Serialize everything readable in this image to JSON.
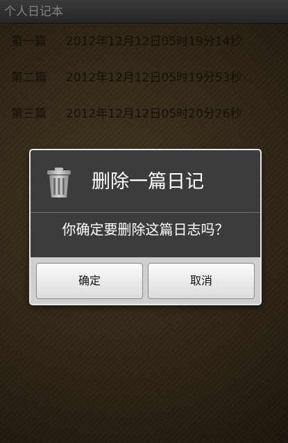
{
  "app": {
    "title": "个人日记本"
  },
  "diary_list": [
    {
      "label": "第一篇",
      "timestamp": "2012年12月12日05时19分14秒"
    },
    {
      "label": "第二篇",
      "timestamp": "2012年12月12日05时19分53秒"
    },
    {
      "label": "第三篇",
      "timestamp": "2012年12月12日05时20分26秒"
    }
  ],
  "dialog": {
    "icon": "trash-icon",
    "title": "删除一篇日记",
    "message": "你确定要删除这篇日志吗？",
    "confirm_label": "确定",
    "cancel_label": "取消"
  },
  "colors": {
    "title_bar": "#3a3a3a",
    "dialog_bg": "#3c3c3c",
    "footer_bg": "#cfcfcf",
    "text_dark": "#1f1a12"
  }
}
